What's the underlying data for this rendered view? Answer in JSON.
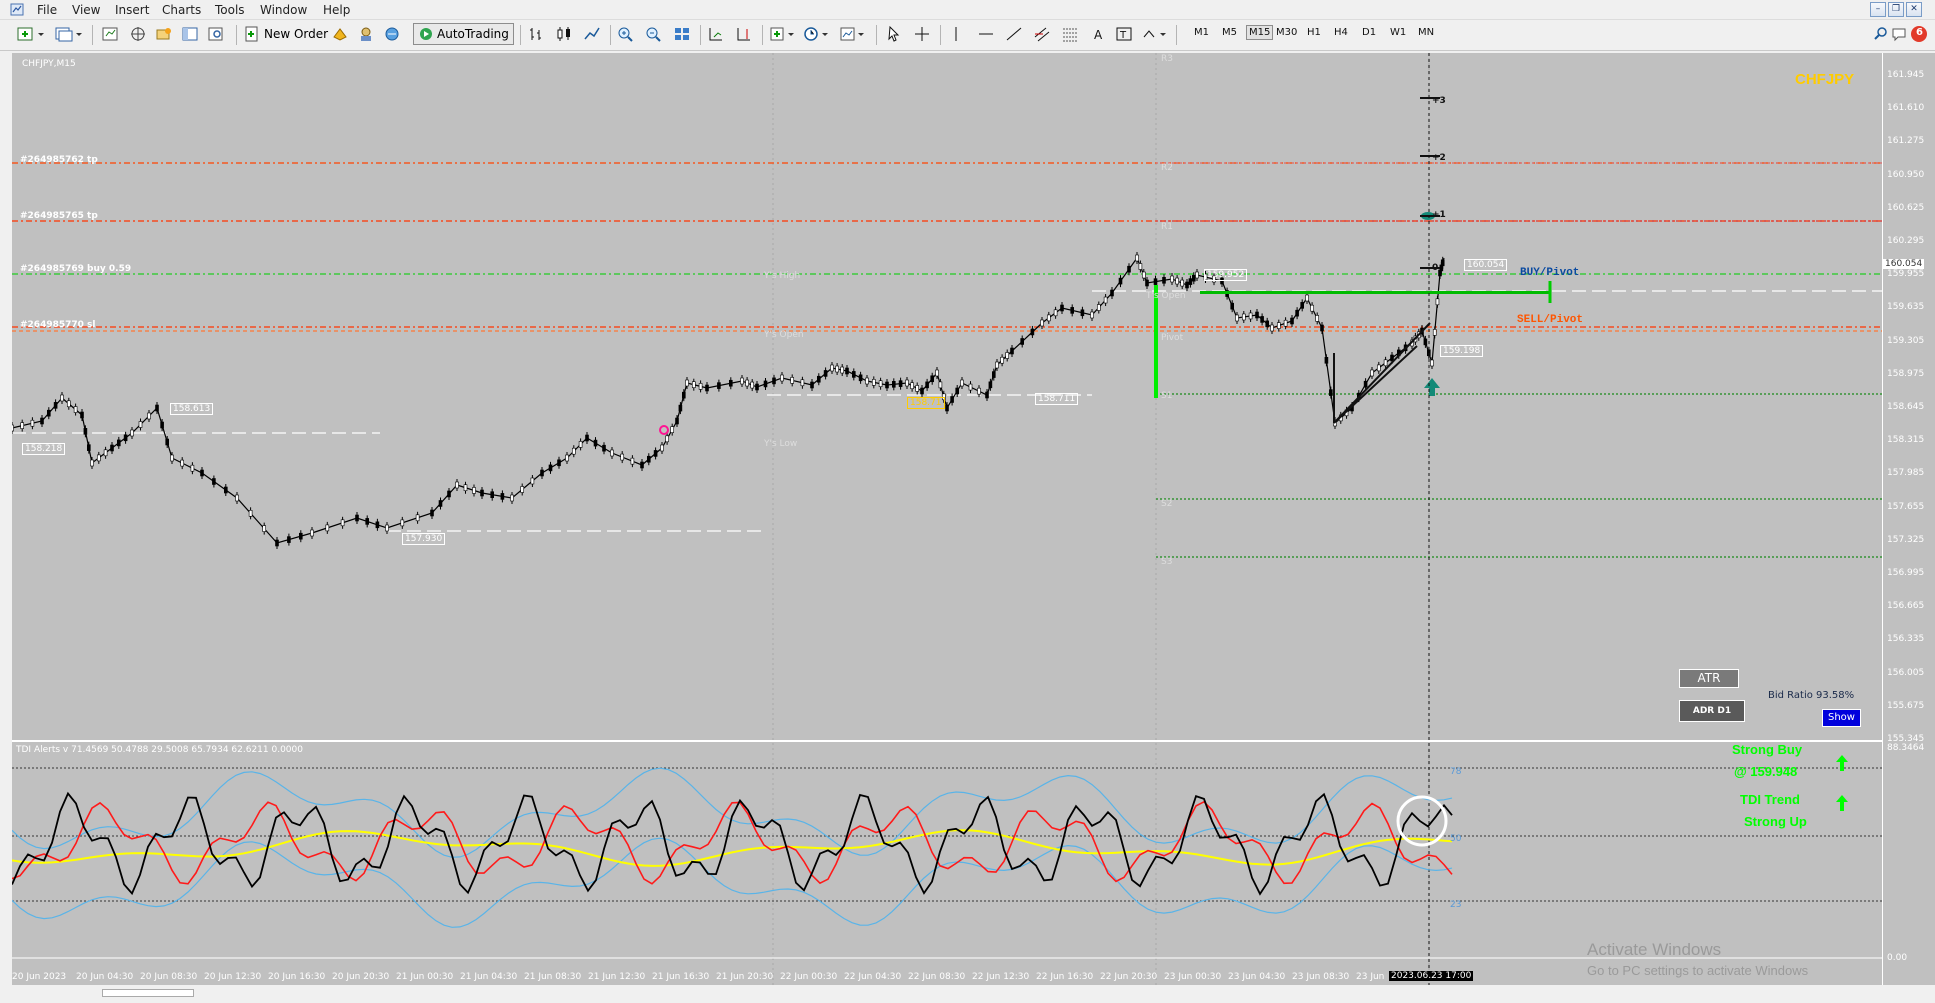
{
  "menu": {
    "items": [
      "File",
      "View",
      "Insert",
      "Charts",
      "Tools",
      "Window",
      "Help"
    ]
  },
  "toolbar": {
    "new_order": "New Order",
    "auto_trading": "AutoTrading",
    "timeframes": [
      "M1",
      "M5",
      "M15",
      "M30",
      "H1",
      "H4",
      "D1",
      "W1",
      "MN"
    ],
    "active_timeframe": "M15",
    "notifications": "6"
  },
  "chart": {
    "symbol_period": "CHFJPY,M15",
    "watermark": "CHFJPY",
    "order_labels": {
      "tp1": "#264985762 tp",
      "tp2": "#264985765 tp",
      "buy": "#264985769 buy 0.59",
      "sl": "#264985770 sl"
    },
    "pivot_labels": {
      "r3": "R3",
      "r2": "R2",
      "r1": "R1",
      "pivot": "Pivot",
      "s1": "S1",
      "s2": "S2",
      "s3": "S3"
    },
    "ys_labels": {
      "high": "Y's High",
      "open": "Y's Open",
      "low": "Y's Low",
      "t_open": "T's Open"
    },
    "buy_pivot": "BUY/Pivot",
    "sell_pivot": "SELL/Pivot",
    "price_boxes": [
      "158.613",
      "158.218",
      "157.930",
      "158.71",
      "158.711",
      "159.952",
      "160.054",
      "159.198"
    ],
    "marks": [
      "+3",
      "+2",
      "+1",
      "0"
    ],
    "current_price": "160.054",
    "atr_button": "ATR",
    "adr_button": "ADR D1",
    "bid_ratio": "Bid Ratio 93.58%",
    "show_button": "Show",
    "signal_buy": "Strong Buy",
    "signal_price": "@ 159.948",
    "signal_trend": "TDI Trend",
    "signal_trend2": "Strong Up",
    "colors": {
      "bg": "#c0c0c0",
      "watermark": "#ffcc00",
      "buy_green": "#00ff00",
      "sell_orange": "#ff5500",
      "tp_red": "#ff3300",
      "signal_green": "#00ff00"
    }
  },
  "indicator": {
    "label": "TDI Alerts v 71.4569 50.4788 29.5008 65.7934 62.6211 0.0000",
    "levels": [
      "78",
      "50",
      "23"
    ],
    "axis_top": "88.3464",
    "axis_bottom": "0.00"
  },
  "price_axis": [
    "161.945",
    "161.610",
    "161.275",
    "160.950",
    "160.625",
    "160.295",
    "159.955",
    "159.635",
    "159.305",
    "158.975",
    "158.645",
    "158.315",
    "157.985",
    "157.655",
    "157.325",
    "156.995",
    "156.665",
    "156.335",
    "156.005",
    "155.675",
    "155.345"
  ],
  "time_axis": [
    "20 Jun 2023",
    "20 Jun 04:30",
    "20 Jun 08:30",
    "20 Jun 12:30",
    "20 Jun 16:30",
    "20 Jun 20:30",
    "21 Jun 00:30",
    "21 Jun 04:30",
    "21 Jun 08:30",
    "21 Jun 12:30",
    "21 Jun 16:30",
    "21 Jun 20:30",
    "22 Jun 00:30",
    "22 Jun 04:30",
    "22 Jun 08:30",
    "22 Jun 12:30",
    "22 Jun 16:30",
    "22 Jun 20:30",
    "23 Jun 00:30",
    "23 Jun 04:30",
    "23 Jun 08:30",
    "23 Jun"
  ],
  "cursor_time": "2023.06.23 17:00",
  "activate": {
    "title": "Activate Windows",
    "sub": "Go to PC settings to activate Windows"
  }
}
